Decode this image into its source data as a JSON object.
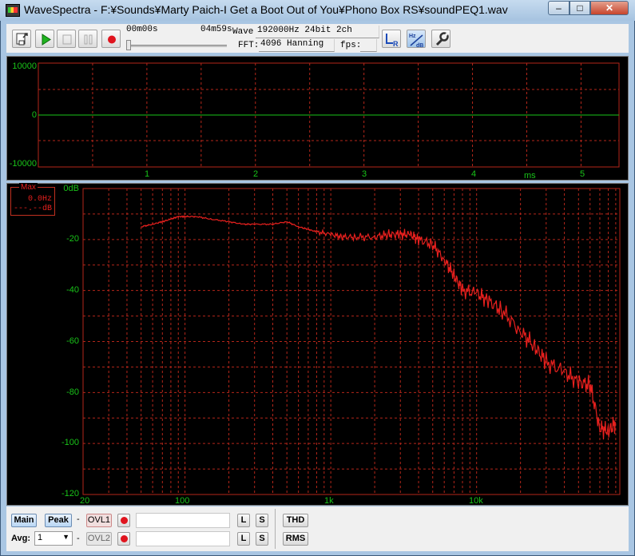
{
  "window": {
    "title": "WaveSpectra - F:¥Sounds¥Marty Paich-I Get a Boot Out of You¥Phono Box RS¥soundPEQ1.wav",
    "min_glyph": "–",
    "max_glyph": "□",
    "close_glyph": "✕"
  },
  "toolbar": {
    "time_start": "00m00s",
    "time_end": "04m59s",
    "wave_label": "Wave:",
    "wave_value": "192000Hz 24bit 2ch",
    "fft_label": "FFT:",
    "fft_value": "4096 Hanning",
    "fps_label": "fps:",
    "fps_value": "",
    "slider_position": 0,
    "icons": [
      "open-file-icon",
      "play-icon",
      "stop-icon",
      "pause-icon",
      "record-icon",
      "lr-channel-icon",
      "hz-db-scale-icon",
      "settings-wrench-icon"
    ]
  },
  "wave_panel": {
    "y_labels": [
      "10000",
      "0",
      "-10000"
    ],
    "x_labels": [
      "1",
      "2",
      "3",
      "4",
      "5"
    ],
    "x_unit": "ms",
    "trace_color": "#19c319",
    "grid_color": "#b4261a"
  },
  "spectrum_panel": {
    "y_labels": [
      "0dB",
      "-20",
      "-40",
      "-60",
      "-80",
      "-100",
      "-120"
    ],
    "x_labels": [
      "20",
      "100",
      "1k",
      "10k"
    ],
    "peak_box": {
      "title": "Max",
      "freq": "0.0Hz",
      "db": "---.--dB"
    },
    "trace_color": "#e8201e",
    "grid_color": "#b4261a"
  },
  "chart_data": {
    "type": "line",
    "x_scale": "log",
    "xlim": [
      20,
      96000
    ],
    "ylim": [
      -120,
      0
    ],
    "x": [
      50,
      60,
      70,
      80,
      90,
      100,
      120,
      150,
      200,
      250,
      300,
      400,
      500,
      600,
      700,
      800,
      1000,
      1200,
      1500,
      2000,
      2500,
      3000,
      3500,
      4000,
      5000,
      6000,
      7000,
      8000,
      10000,
      12000,
      15000,
      20000,
      25000,
      30000,
      40000,
      50000,
      60000,
      70000,
      80000,
      90000
    ],
    "series": [
      {
        "values": [
          -15,
          -14,
          -13,
          -12,
          -11,
          -11,
          -11,
          -12,
          -13,
          -14,
          -14,
          -14,
          -13,
          -15,
          -16,
          -17,
          -18,
          -19,
          -19,
          -19,
          -18,
          -18,
          -18,
          -20,
          -22,
          -28,
          -34,
          -40,
          -41,
          -44,
          -48,
          -56,
          -62,
          -68,
          -72,
          -76,
          -77,
          -94,
          -95,
          -92
        ]
      }
    ]
  },
  "bottom": {
    "main_label": "Main",
    "peak_label": "Peak",
    "dash": "-",
    "ovl1_label": "OVL1",
    "ovl2_label": "OVL2",
    "l_label": "L",
    "s_label": "S",
    "thd_label": "THD",
    "rms_label": "RMS",
    "avg_label": "Avg:",
    "avg_value": "1"
  }
}
